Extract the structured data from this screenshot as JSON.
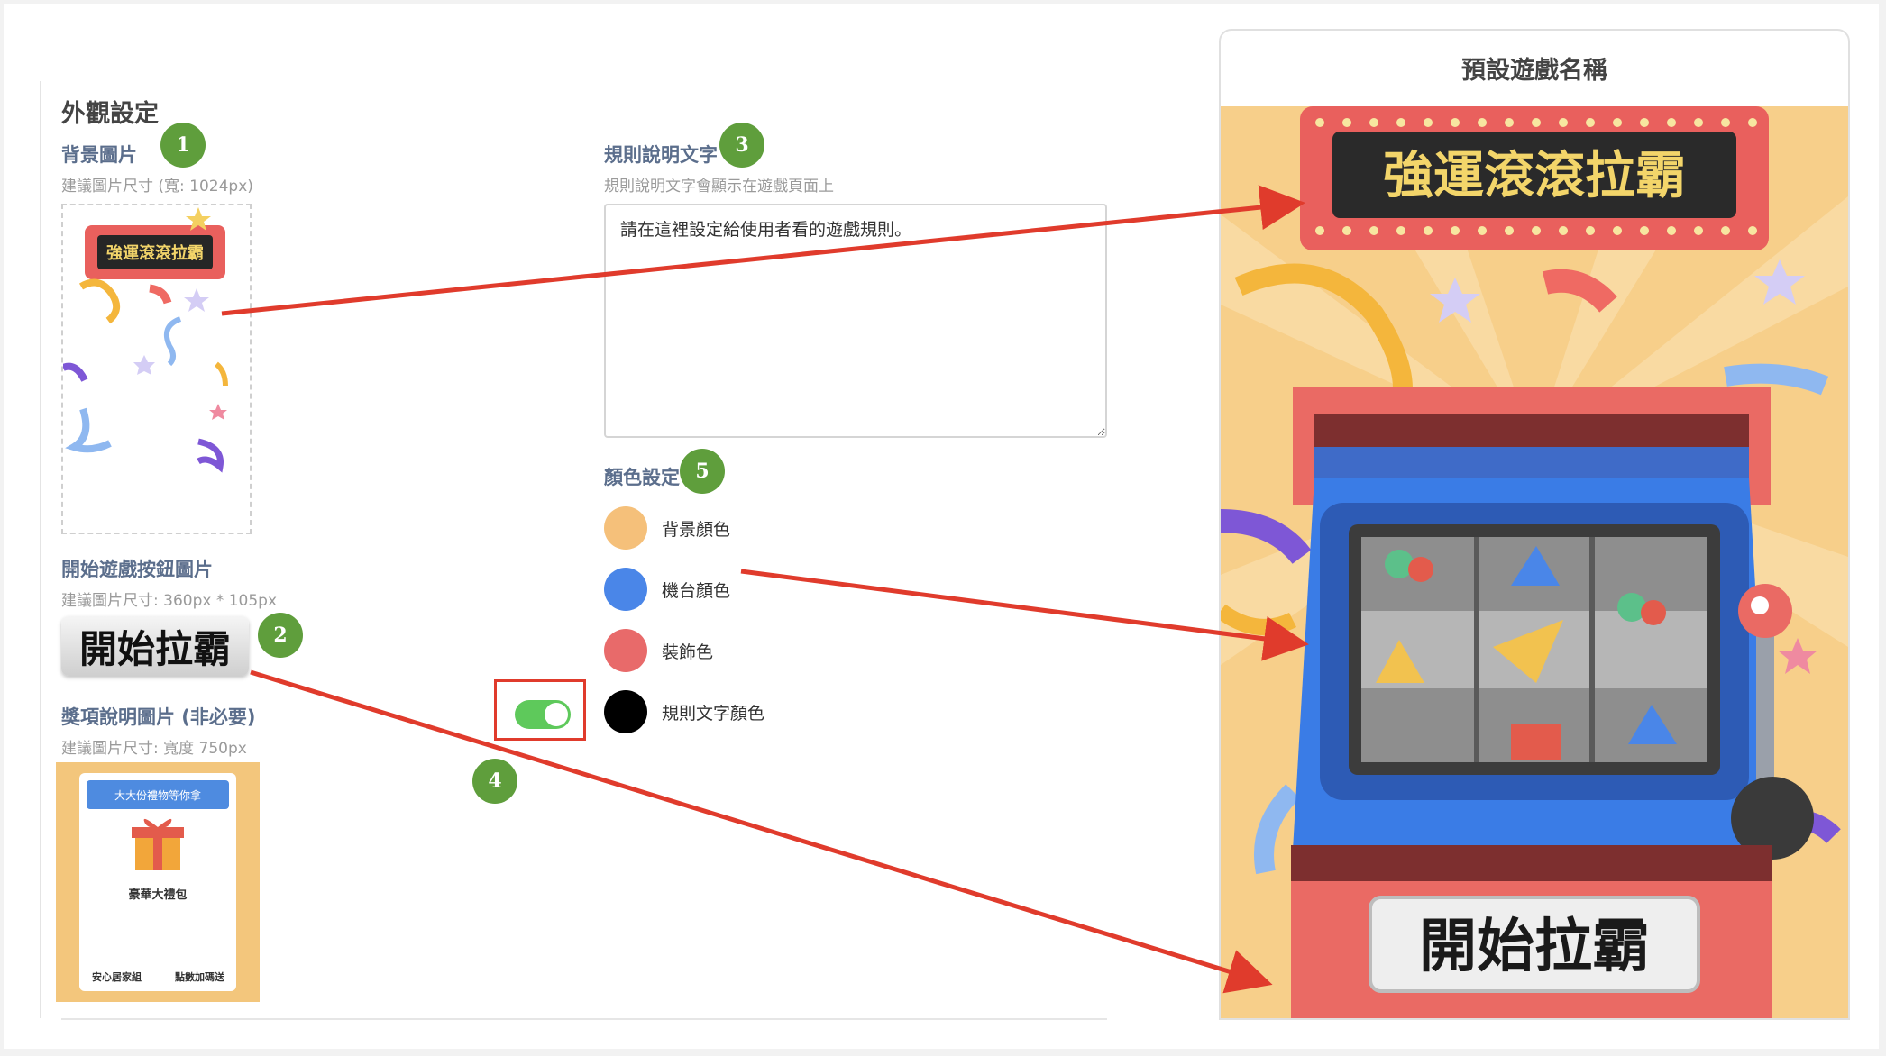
{
  "section": {
    "title": "外觀設定"
  },
  "background": {
    "label": "背景圖片",
    "hint": "建議圖片尺寸 (寬: 1024px)",
    "sign_text": "強運滾滾拉霸"
  },
  "start_button": {
    "label": "開始遊戲按鈕圖片",
    "hint": "建議圖片尺寸: 360px * 105px",
    "image_text": "開始拉霸"
  },
  "prize": {
    "label": "獎項說明圖片 (非必要)",
    "hint": "建議圖片尺寸: 寬度 750px",
    "banner": "大大份禮物等你拿",
    "item_main": "豪華大禮包",
    "item_left": "安心居家組",
    "item_right": "點數加碼送"
  },
  "rules": {
    "label": "規則說明文字",
    "hint": "規則說明文字會顯示在遊戲頁面上",
    "value": "請在這裡設定給使用者看的遊戲規則。"
  },
  "colors": {
    "label": "顏色設定",
    "items": [
      {
        "label": "背景顏色",
        "color": "#f5c07a"
      },
      {
        "label": "機台顏色",
        "color": "#4a86e8"
      },
      {
        "label": "裝飾色",
        "color": "#e86a6a"
      },
      {
        "label": "規則文字顏色",
        "color": "#000000"
      }
    ]
  },
  "badges": [
    "1",
    "2",
    "3",
    "4",
    "5"
  ],
  "toggle": {
    "state": "on"
  },
  "preview": {
    "title": "預設遊戲名稱",
    "sign_text": "強運滾滾拉霸",
    "button_text": "開始拉霸"
  },
  "accent_colors": {
    "arrow": "#e03b2c",
    "badge": "#5f9e3c",
    "toggle": "#5ec95b"
  }
}
